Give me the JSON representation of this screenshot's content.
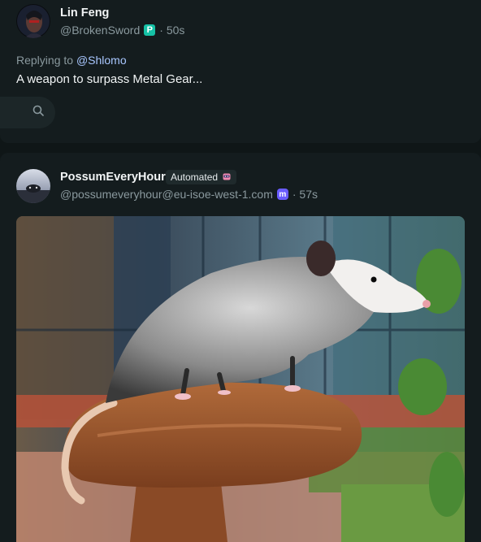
{
  "post1": {
    "author_name": "Lin Feng",
    "handle": "@BrokenSword",
    "time": "· 50s",
    "replying_prefix": "Replying to ",
    "replying_to": "@Shlomo",
    "text": "A weapon to surpass Metal Gear...",
    "platform_badge": "P"
  },
  "post2": {
    "author_name": "PossumEveryHour",
    "badge_label": "Automated",
    "handle": "@possumeveryhour@eu-isoe-west-1.com",
    "time": "· 57s",
    "platform_badge": "m"
  },
  "icons": {
    "search": "search-icon",
    "bot": "robot-icon"
  },
  "colors": {
    "background": "#0f1617",
    "card": "#141c1e",
    "link": "#a9c7ff",
    "muted": "#8a999e"
  }
}
